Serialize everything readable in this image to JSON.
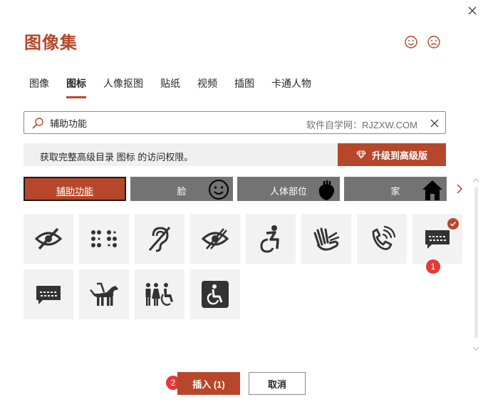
{
  "dialog": {
    "title": "图像集",
    "close_icon": "close-icon",
    "feedback": {
      "happy_icon": "smiley-icon",
      "sad_icon": "frown-icon"
    }
  },
  "tabs": [
    {
      "label": "图像",
      "active": false
    },
    {
      "label": "图标",
      "active": true
    },
    {
      "label": "人像抠图",
      "active": false
    },
    {
      "label": "贴纸",
      "active": false
    },
    {
      "label": "视频",
      "active": false
    },
    {
      "label": "插图",
      "active": false
    },
    {
      "label": "卡通人物",
      "active": false
    }
  ],
  "search": {
    "value": "辅助功能",
    "placeholder": "",
    "watermark": "软件自学网：RJZXW.COM"
  },
  "banner": {
    "message": "获取完整高级目录 图标 的访问权限。",
    "upgrade_label": "升级到高级版",
    "upgrade_icon": "diamond-icon"
  },
  "categories": [
    {
      "label": "辅助功能",
      "active": true,
      "icon": ""
    },
    {
      "label": "脸",
      "active": false,
      "icon": "face-icon"
    },
    {
      "label": "人体部位",
      "active": false,
      "icon": "heart-organ-icon"
    },
    {
      "label": "家",
      "active": false,
      "icon": "house-icon"
    }
  ],
  "icons": [
    {
      "name": "eye-slash-icon",
      "selected": false
    },
    {
      "name": "braille-icon",
      "selected": false
    },
    {
      "name": "hearing-impaired-icon",
      "selected": false
    },
    {
      "name": "low-vision-icon",
      "selected": false
    },
    {
      "name": "active-wheelchair-icon",
      "selected": false
    },
    {
      "name": "sign-language-icon",
      "selected": false
    },
    {
      "name": "volume-control-phone-icon",
      "selected": false
    },
    {
      "name": "closed-captioning-bubble-icon",
      "selected": true
    },
    {
      "name": "tty-bubble-icon",
      "selected": false
    },
    {
      "name": "guide-dog-icon",
      "selected": false
    },
    {
      "name": "accessible-restroom-icon",
      "selected": false
    },
    {
      "name": "accessible-sign-icon",
      "selected": false
    }
  ],
  "badges": {
    "one": "1",
    "two": "2"
  },
  "footer": {
    "insert_label": "插入 (1)",
    "cancel_label": "取消"
  },
  "colors": {
    "accent": "#b7472a",
    "category_bg": "#737373",
    "badge": "#e53935",
    "cell_bg": "#f2f2f2"
  }
}
